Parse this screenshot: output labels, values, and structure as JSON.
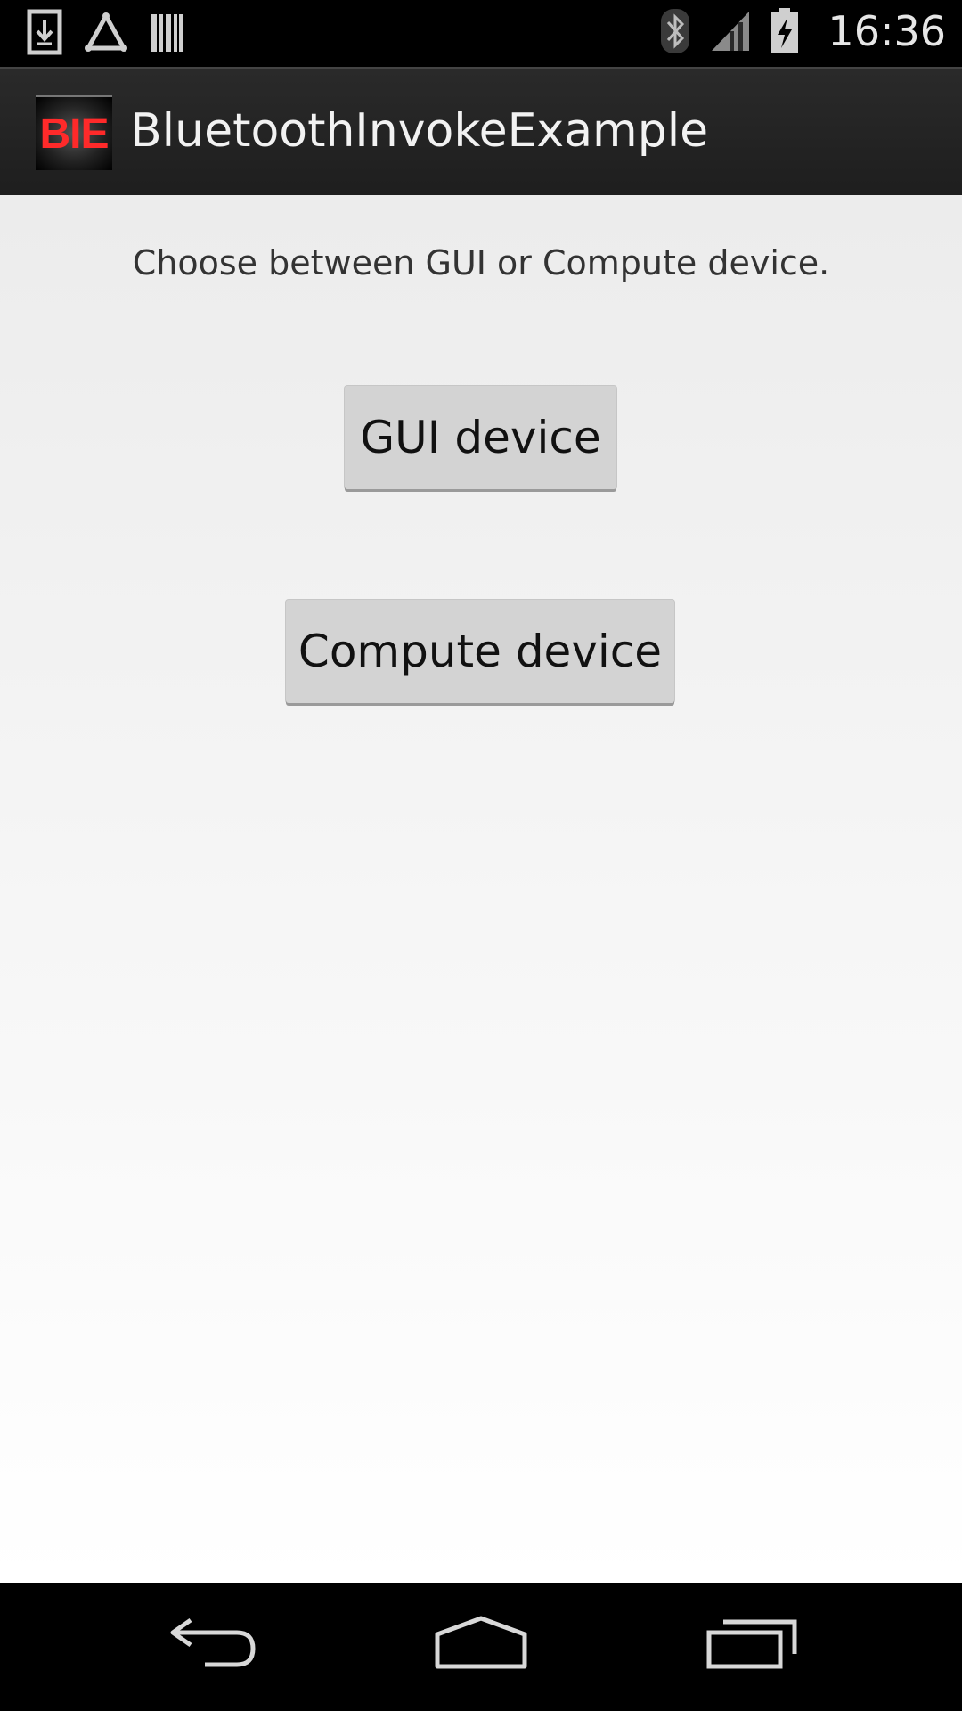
{
  "status_bar": {
    "time": "16:36",
    "icons_left": [
      "download-icon",
      "triangle-notification-icon",
      "barcode-icon"
    ],
    "icons_right": [
      "bluetooth-icon",
      "signal-icon",
      "battery-charging-icon"
    ]
  },
  "action_bar": {
    "app_icon_text": "BIE",
    "title": "BluetoothInvokeExample"
  },
  "main": {
    "prompt": "Choose between GUI or Compute device.",
    "gui_button_label": "GUI device",
    "compute_button_label": "Compute device"
  },
  "nav_bar": {
    "buttons": [
      "back-icon",
      "home-icon",
      "recent-apps-icon"
    ]
  },
  "colors": {
    "status_bar_bg": "#000000",
    "action_bar_bg": "#222222",
    "content_bg_top": "#ececec",
    "content_bg_bottom": "#ffffff",
    "button_bg": "#d3d3d3",
    "app_icon_accent": "#ff2a2a"
  }
}
